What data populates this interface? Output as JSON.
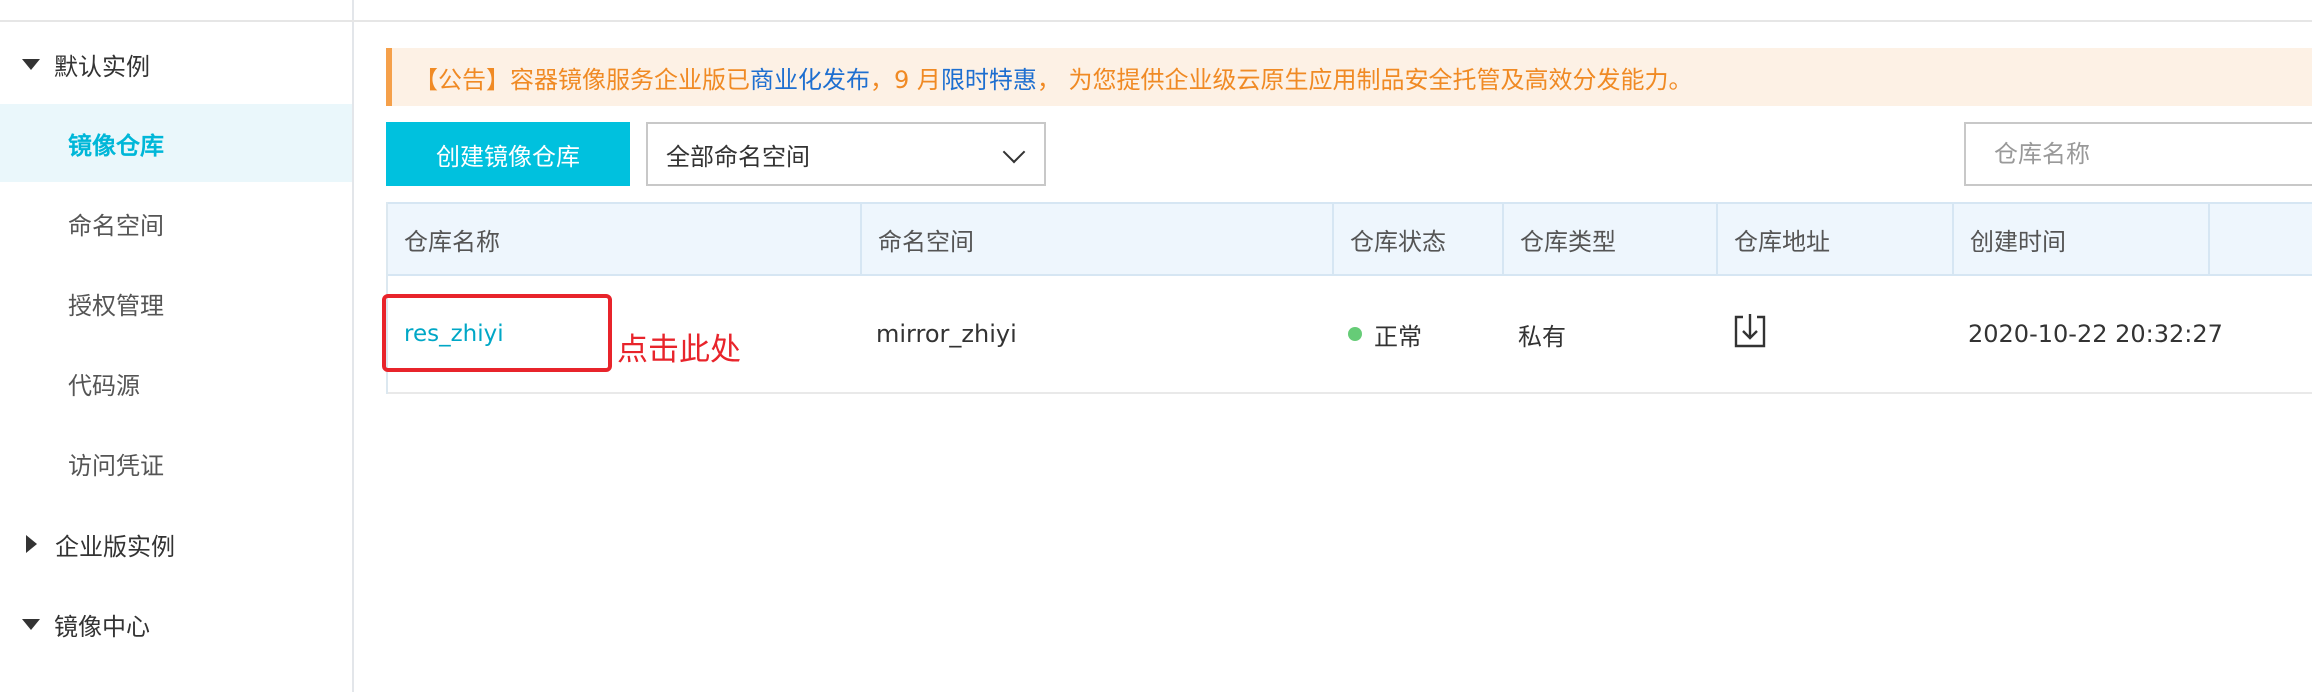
{
  "sidebar": {
    "default_instance": "默认实例",
    "items": [
      {
        "label": "镜像仓库",
        "active": true
      },
      {
        "label": "命名空间",
        "active": false
      },
      {
        "label": "授权管理",
        "active": false
      },
      {
        "label": "代码源",
        "active": false
      },
      {
        "label": "访问凭证",
        "active": false
      }
    ],
    "enterprise_instance": "企业版实例",
    "image_center": "镜像中心"
  },
  "notice": {
    "prefix": "【公告】容器镜像服务企业版已",
    "link1": "商业化发布",
    "middle": "，9 月",
    "link2": "限时特惠",
    "suffix": "， 为您提供企业级云原生应用制品安全托管及高效分发能力。"
  },
  "toolbar": {
    "create_button": "创建镜像仓库",
    "namespace_select": "全部命名空间",
    "search_placeholder": "仓库名称"
  },
  "table": {
    "columns": [
      "仓库名称",
      "命名空间",
      "仓库状态",
      "仓库类型",
      "仓库地址",
      "创建时间"
    ],
    "rows": [
      {
        "name": "res_zhiyi",
        "namespace": "mirror_zhiyi",
        "status": "正常",
        "type": "私有",
        "address_icon": "download-icon",
        "created": "2020-10-22 20:32:27"
      }
    ]
  },
  "annotation": {
    "text": "点击此处",
    "color": "#e8242b"
  },
  "colors": {
    "accent": "#00c1de",
    "link": "#00a7c6",
    "notice_text": "#f08a24",
    "status_ok": "#66cc77"
  }
}
